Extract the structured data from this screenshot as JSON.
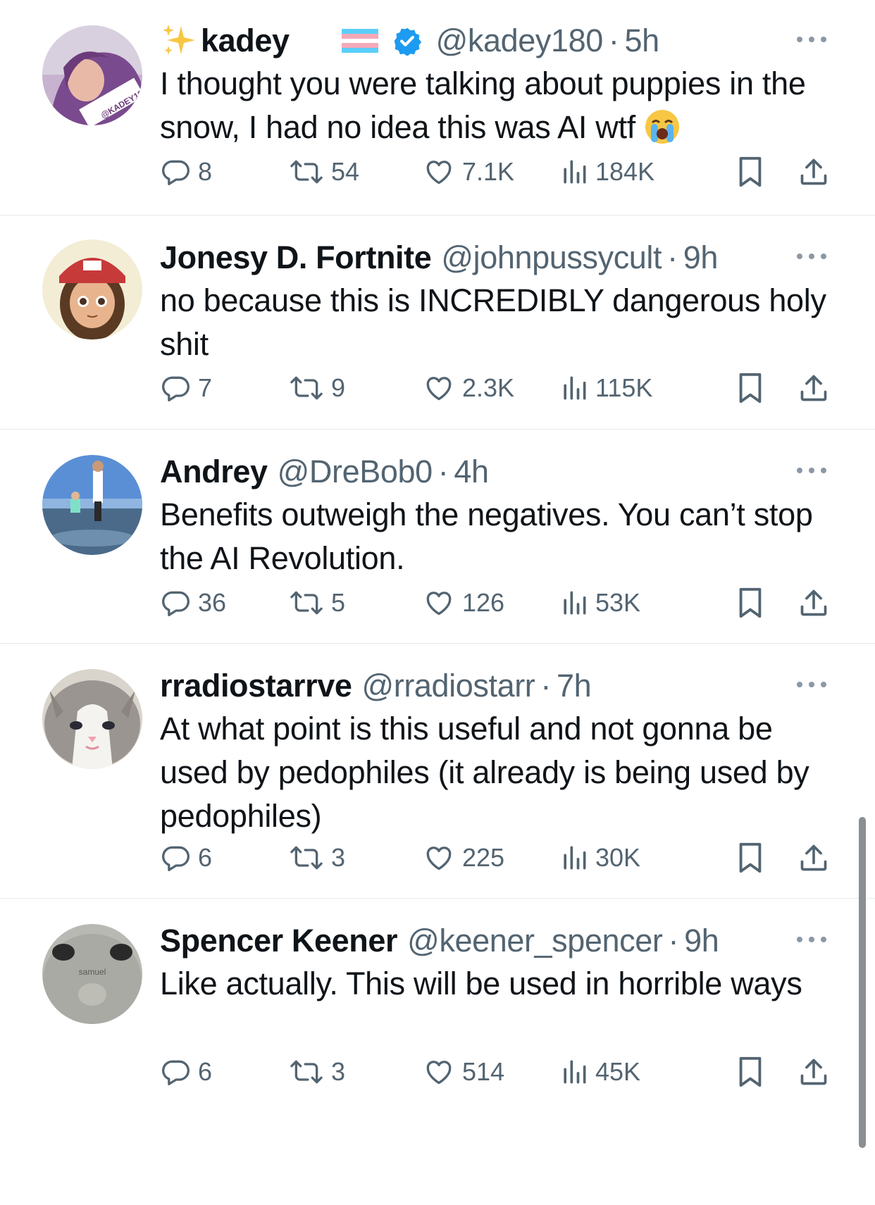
{
  "tweets": [
    {
      "name": "kadey",
      "handle": "@kadey180",
      "time": "5h",
      "verified": true,
      "text": "I thought you were talking about puppies in the snow, I had no idea this was AI wtf",
      "replies": "8",
      "reposts": "54",
      "likes": "7.1K",
      "views": "184K",
      "avatar_icon": "avatar-photo-selfie"
    },
    {
      "name": "Jonesy D. Fortnite",
      "handle": "@johnpussycult",
      "time": "9h",
      "text": "no because this is INCREDIBLY dangerous holy shit",
      "replies": "7",
      "reposts": "9",
      "likes": "2.3K",
      "views": "115K",
      "avatar_icon": "avatar-anime-character"
    },
    {
      "name": "Andrey",
      "handle": "@DreBob0",
      "time": "4h",
      "text": "Benefits outweigh the negatives. You can’t stop the AI Revolution.",
      "replies": "36",
      "reposts": "5",
      "likes": "126",
      "views": "53K",
      "avatar_icon": "avatar-beach-photo"
    },
    {
      "name": "rradiostarrve",
      "handle": "@rradiostarr",
      "time": "7h",
      "text": "At what point is this useful and not gonna be used by pedophiles (it already is being used by pedophiles)",
      "replies": "6",
      "reposts": "3",
      "likes": "225",
      "views": "30K",
      "avatar_icon": "avatar-kitten"
    },
    {
      "name": "Spencer Keener",
      "handle": "@keener_spencer",
      "time": "9h",
      "text": "Like actually. This will be used in horrible ways",
      "replies": "6",
      "reposts": "3",
      "likes": "514",
      "views": "45K",
      "avatar_icon": "avatar-mouse",
      "avatar_caption": "samuel"
    }
  ],
  "colors": {
    "text": "#0f1419",
    "secondary": "#536471",
    "divider": "#e6e9ec",
    "verified": "#1d9bf0"
  }
}
